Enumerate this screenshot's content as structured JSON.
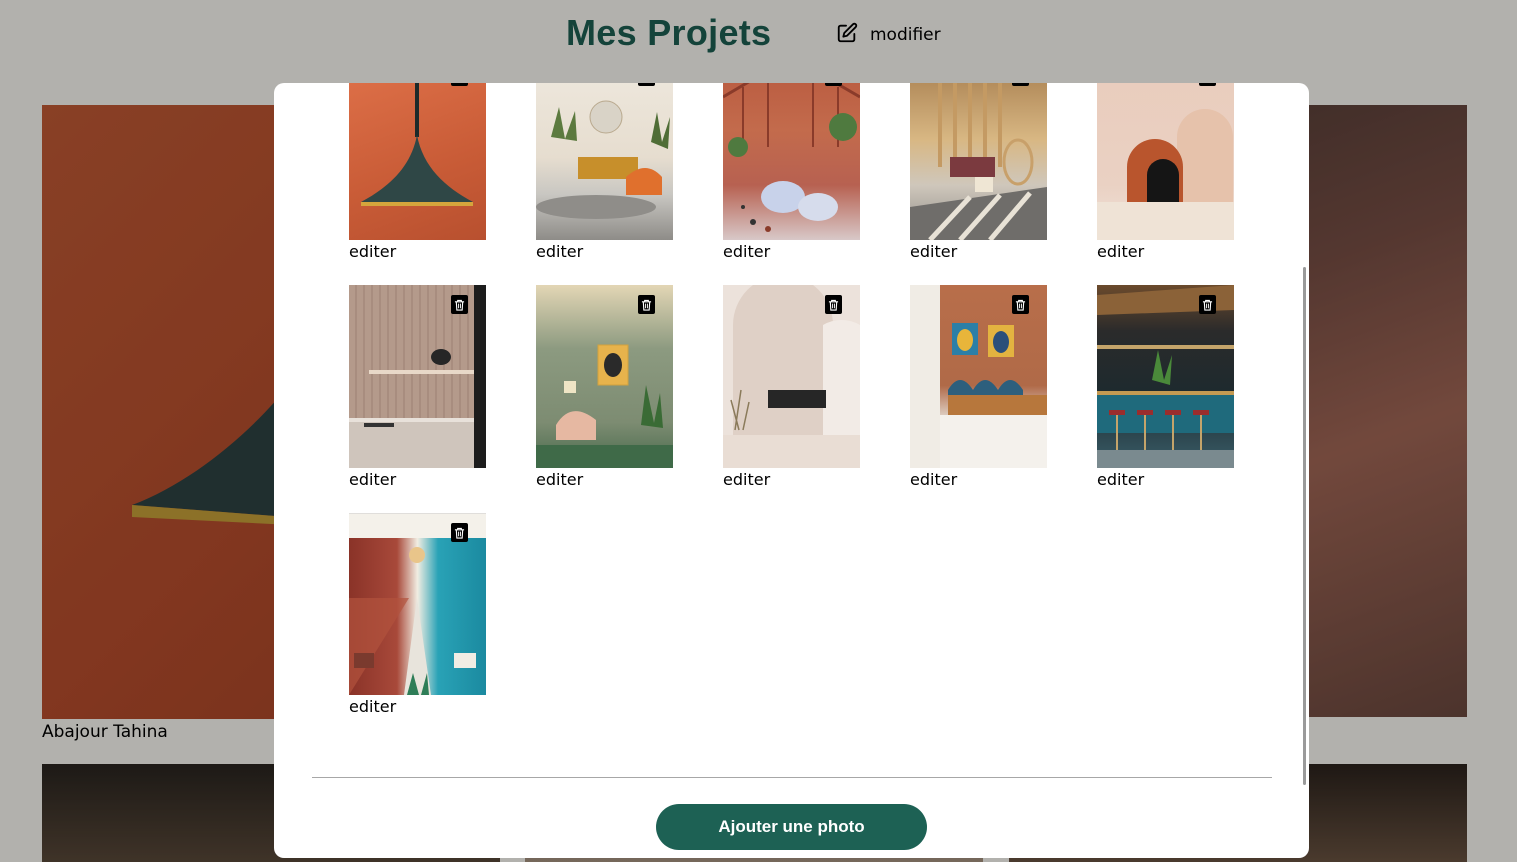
{
  "header": {
    "title": "Mes Projets",
    "edit_label": "modifier"
  },
  "background": {
    "first_caption": "Abajour Tahina"
  },
  "modal": {
    "tiles": [
      {
        "edit_label": "editer",
        "scene": "orange-wall-pendant-lamp"
      },
      {
        "edit_label": "editer",
        "scene": "living-room-orange-armchair"
      },
      {
        "edit_label": "editer",
        "scene": "greenhouse-restaurant"
      },
      {
        "edit_label": "editer",
        "scene": "sunlit-terrace-hanging-chair"
      },
      {
        "edit_label": "editer",
        "scene": "beige-arches-still-life"
      },
      {
        "edit_label": "editer",
        "scene": "wood-panel-kitchen"
      },
      {
        "edit_label": "editer",
        "scene": "green-living-room"
      },
      {
        "edit_label": "editer",
        "scene": "white-arch-room-black-sofa"
      },
      {
        "edit_label": "editer",
        "scene": "terracotta-bedroom"
      },
      {
        "edit_label": "editer",
        "scene": "teal-bar"
      },
      {
        "edit_label": "editer",
        "scene": "long-cafe-hall"
      }
    ],
    "add_button_label": "Ajouter une photo"
  },
  "colors": {
    "accent": "#1d6154",
    "overlay": "rgba(0,0,0,0.30)"
  },
  "icons": {
    "edit": "pen-square-icon",
    "delete": "trash-icon"
  }
}
